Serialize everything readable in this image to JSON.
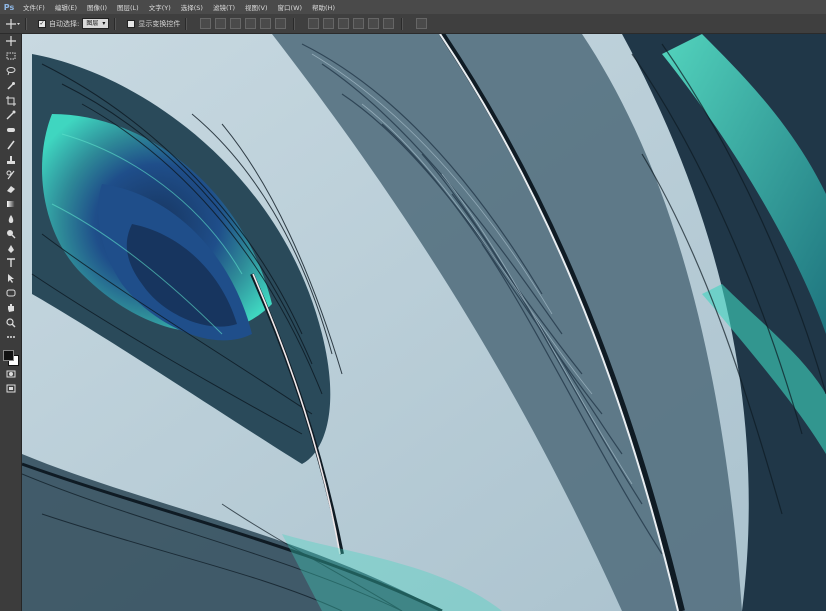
{
  "app": {
    "logo": "Ps"
  },
  "menu": [
    "文件(F)",
    "编辑(E)",
    "图像(I)",
    "图层(L)",
    "文字(Y)",
    "选择(S)",
    "滤镜(T)",
    "视图(V)",
    "窗口(W)",
    "帮助(H)"
  ],
  "options": {
    "auto_select_label": "自动选择:",
    "auto_select_value": "图层",
    "show_transform_label": "显示变换控件"
  },
  "tools": [
    "move-tool",
    "marquee-tool",
    "lasso-tool",
    "quick-select-tool",
    "crop-tool",
    "eyedropper-tool",
    "spot-heal-tool",
    "brush-tool",
    "clone-stamp-tool",
    "history-brush-tool",
    "eraser-tool",
    "gradient-tool",
    "blur-tool",
    "dodge-tool",
    "pen-tool",
    "type-tool",
    "path-select-tool",
    "shape-tool",
    "hand-tool",
    "zoom-tool",
    "more-tools"
  ],
  "colors": {
    "foreground": "#111111",
    "background": "#ffffff",
    "canvas_bg": "#b9cdd7",
    "accent_teal": "#3fd6c0",
    "feather_blue": "#1f4e8a"
  }
}
